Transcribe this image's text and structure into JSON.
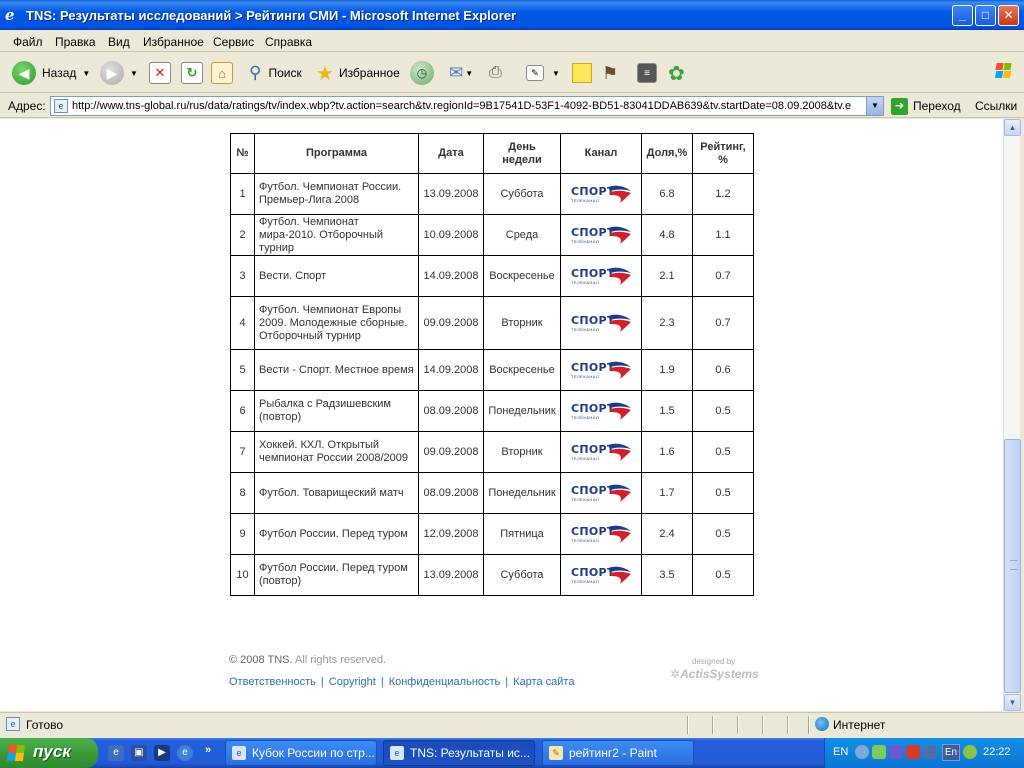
{
  "window": {
    "title": "TNS: Результаты исследований > Рейтинги СМИ - Microsoft Internet Explorer",
    "controls": {
      "minimize": "_",
      "maximize": "□",
      "close": "✕"
    }
  },
  "menu": [
    "Файл",
    "Правка",
    "Вид",
    "Избранное",
    "Сервис",
    "Справка"
  ],
  "toolbar": {
    "back": "Назад",
    "search": "Поиск",
    "favorites": "Избранное"
  },
  "address": {
    "label": "Адрес:",
    "url": "http://www.tns-global.ru/rus/data/ratings/tv/index.wbp?tv.action=search&tv.regionId=9B17541D-53F1-4092-BD51-83041DDAB639&tv.startDate=08.09.2008&tv.e",
    "go": "Переход",
    "links": "Ссылки"
  },
  "table": {
    "headers": [
      "№",
      "Программа",
      "Дата",
      "День недели",
      "Канал",
      "Доля,%",
      "Рейтинг, %"
    ],
    "channel_logo": {
      "text": "СПОРТ",
      "sub": "ТЕЛЕКАНАЛ"
    },
    "rows": [
      {
        "n": "1",
        "program": "Футбол. Чемпионат России. Премьер-Лига 2008",
        "date": "13.09.2008",
        "day": "Суббота",
        "share": "6.8",
        "rating": "1.2"
      },
      {
        "n": "2",
        "program": "Футбол. Чемпионат мира-2010. Отборочный турнир",
        "date": "10.09.2008",
        "day": "Среда",
        "share": "4.8",
        "rating": "1.1"
      },
      {
        "n": "3",
        "program": "Вести. Спорт",
        "date": "14.09.2008",
        "day": "Воскресенье",
        "share": "2.1",
        "rating": "0.7"
      },
      {
        "n": "4",
        "program": "Футбол. Чемпионат Европы 2009. Молодежные сборные. Отборочный турнир",
        "date": "09.09.2008",
        "day": "Вторник",
        "share": "2.3",
        "rating": "0.7"
      },
      {
        "n": "5",
        "program": "Вести - Спорт. Местное время",
        "date": "14.09.2008",
        "day": "Воскресенье",
        "share": "1.9",
        "rating": "0.6"
      },
      {
        "n": "6",
        "program": "Рыбалка с Радзишевским (повтор)",
        "date": "08.09.2008",
        "day": "Понедельник",
        "share": "1.5",
        "rating": "0.5"
      },
      {
        "n": "7",
        "program": "Хоккей. КХЛ. Открытый чемпионат России 2008/2009",
        "date": "09.09.2008",
        "day": "Вторник",
        "share": "1.6",
        "rating": "0.5"
      },
      {
        "n": "8",
        "program": "Футбол. Товарищеский матч",
        "date": "08.09.2008",
        "day": "Понедельник",
        "share": "1.7",
        "rating": "0.5"
      },
      {
        "n": "9",
        "program": "Футбол России. Перед туром",
        "date": "12.09.2008",
        "day": "Пятница",
        "share": "2.4",
        "rating": "0.5"
      },
      {
        "n": "10",
        "program": "Футбол России. Перед туром (повтор)",
        "date": "13.09.2008",
        "day": "Суббота",
        "share": "3.5",
        "rating": "0.5"
      }
    ]
  },
  "footer": {
    "copyright_strong": "© 2008 TNS.",
    "copyright_rest": " All rights reserved.",
    "links": [
      "Ответственность",
      "Copyright",
      "Конфиденциальность",
      "Карта сайта"
    ],
    "designed_by": "designed by",
    "designer": "ActisSystems"
  },
  "status": {
    "text": "Готово",
    "zone": "Интернет"
  },
  "taskbar": {
    "start": "пуск",
    "tasks": [
      {
        "label": "Кубок России по стр...",
        "active": false
      },
      {
        "label": "TNS: Результаты ис...",
        "active": true
      },
      {
        "label": "рейтинг2 - Paint",
        "active": false
      }
    ],
    "lang": "EN",
    "lang_indicator": "En",
    "clock": "22:22"
  },
  "colors": {
    "titlebar": "#0055E2",
    "chrome": "#ECE9D8",
    "link": "#2C71A6",
    "taskbar": "#245EDC",
    "start": "#3A9A3A",
    "tray": "#0C74D4",
    "logo_blue": "#1E3B8A",
    "logo_red": "#D4202A"
  }
}
